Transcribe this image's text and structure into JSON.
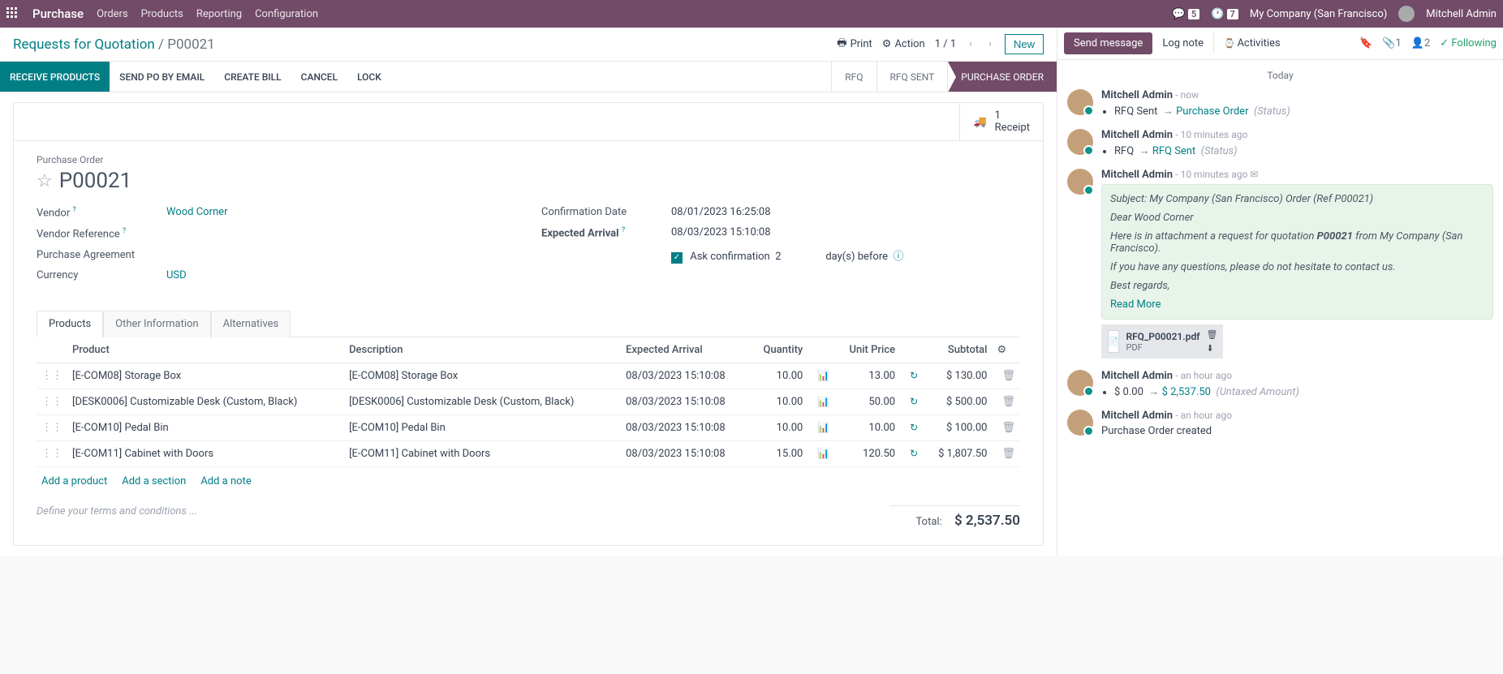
{
  "topbar": {
    "brand": "Purchase",
    "menu": [
      "Orders",
      "Products",
      "Reporting",
      "Configuration"
    ],
    "messages_count": "5",
    "activities_count": "7",
    "company": "My Company (San Francisco)",
    "user": "Mitchell Admin"
  },
  "breadcrumb": {
    "root": "Requests for Quotation",
    "current": "P00021",
    "print": "Print",
    "action": "Action",
    "pager": "1 / 1",
    "new": "New"
  },
  "actions": {
    "receive": "RECEIVE PRODUCTS",
    "send": "SEND PO BY EMAIL",
    "bill": "CREATE BILL",
    "cancel": "CANCEL",
    "lock": "LOCK"
  },
  "statuses": [
    "RFQ",
    "RFQ SENT",
    "PURCHASE ORDER"
  ],
  "stat": {
    "count": "1",
    "label": "Receipt"
  },
  "form": {
    "title_label": "Purchase Order",
    "name": "P00021",
    "vendor_label": "Vendor",
    "vendor": "Wood Corner",
    "vendor_ref_label": "Vendor Reference",
    "agreement_label": "Purchase Agreement",
    "currency_label": "Currency",
    "currency": "USD",
    "confirm_label": "Confirmation Date",
    "confirm_date": "08/01/2023 16:25:08",
    "arrival_label": "Expected Arrival",
    "arrival_date": "08/03/2023 15:10:08",
    "ask_label": "Ask confirmation",
    "ask_days": "2",
    "ask_suffix": "day(s) before"
  },
  "tabs": [
    "Products",
    "Other Information",
    "Alternatives"
  ],
  "table": {
    "headers": {
      "product": "Product",
      "desc": "Description",
      "arrival": "Expected Arrival",
      "qty": "Quantity",
      "unit": "Unit Price",
      "subtotal": "Subtotal"
    },
    "rows": [
      {
        "product": "[E-COM08] Storage Box",
        "desc": "[E-COM08] Storage Box",
        "arrival": "08/03/2023 15:10:08",
        "qty": "10.00",
        "unit": "13.00",
        "subtotal": "$ 130.00"
      },
      {
        "product": "[DESK0006] Customizable Desk (Custom, Black)",
        "desc": "[DESK0006] Customizable Desk (Custom, Black)",
        "arrival": "08/03/2023 15:10:08",
        "qty": "10.00",
        "unit": "50.00",
        "subtotal": "$ 500.00"
      },
      {
        "product": "[E-COM10] Pedal Bin",
        "desc": "[E-COM10] Pedal Bin",
        "arrival": "08/03/2023 15:10:08",
        "qty": "10.00",
        "unit": "10.00",
        "subtotal": "$ 100.00"
      },
      {
        "product": "[E-COM11] Cabinet with Doors",
        "desc": "[E-COM11] Cabinet with Doors",
        "arrival": "08/03/2023 15:10:08",
        "qty": "15.00",
        "unit": "120.50",
        "subtotal": "$ 1,807.50"
      }
    ],
    "add_product": "Add a product",
    "add_section": "Add a section",
    "add_note": "Add a note"
  },
  "footer": {
    "terms": "Define your terms and conditions ...",
    "total_label": "Total:",
    "total": "$ 2,537.50"
  },
  "chatter": {
    "send": "Send message",
    "log": "Log note",
    "activities": "Activities",
    "attach_count": "1",
    "follower_count": "2",
    "following": "Following",
    "today": "Today",
    "msgs": [
      {
        "author": "Mitchell Admin",
        "time": "now",
        "field": "RFQ Sent",
        "new": "Purchase Order",
        "status": "(Status)"
      },
      {
        "author": "Mitchell Admin",
        "time": "10 minutes ago",
        "field": "RFQ",
        "new": "RFQ Sent",
        "status": "(Status)"
      }
    ],
    "email": {
      "author": "Mitchell Admin",
      "time": "10 minutes ago",
      "subject": "Subject: My Company (San Francisco) Order (Ref P00021)",
      "greeting": "Dear Wood Corner",
      "line1a": "Here is in attachment a request for quotation ",
      "line1b": "P00021",
      "line1c": " from My Company (San Francisco).",
      "line2": "If you have any questions, please do not hesitate to contact us.",
      "closing": "Best regards,",
      "read_more": "Read More",
      "attachment": "RFQ_P00021.pdf",
      "attach_type": "PDF"
    },
    "untaxed": {
      "author": "Mitchell Admin",
      "time": "an hour ago",
      "old": "$ 0.00",
      "new": "$ 2,537.50",
      "label": "(Untaxed Amount)"
    },
    "created": {
      "author": "Mitchell Admin",
      "time": "an hour ago",
      "text": "Purchase Order created"
    }
  }
}
